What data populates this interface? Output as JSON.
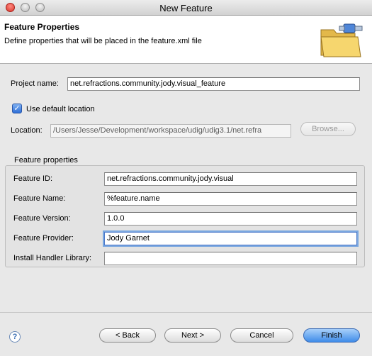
{
  "window": {
    "title": "New Feature"
  },
  "header": {
    "title": "Feature Properties",
    "description": "Define properties that will be placed in the feature.xml file",
    "icon": "folder-wizard-icon"
  },
  "project": {
    "label": "Project name:",
    "value": "net.refractions.community.jody.visual_feature"
  },
  "location": {
    "use_default_label": "Use default location",
    "use_default_checked": true,
    "label": "Location:",
    "value": "/Users/Jesse/Development/workspace/udig/udig3.1/net.refra",
    "browse_label": "Browse..."
  },
  "feature_properties": {
    "group_label": "Feature properties",
    "id": {
      "label": "Feature ID:",
      "value": "net.refractions.community.jody.visual"
    },
    "name": {
      "label": "Feature Name:",
      "value": "%feature.name"
    },
    "version": {
      "label": "Feature Version:",
      "value": "1.0.0"
    },
    "provider": {
      "label": "Feature Provider:",
      "value": "Jody Garnet"
    },
    "install_handler": {
      "label": "Install Handler Library:",
      "value": ""
    }
  },
  "buttons": {
    "back": "< Back",
    "next": "Next >",
    "cancel": "Cancel",
    "finish": "Finish",
    "help_icon": "help-icon"
  },
  "colors": {
    "primary_button": "#3f8ce9",
    "checkbox": "#2f6fd6",
    "focus_ring": "#7aa7e0"
  }
}
